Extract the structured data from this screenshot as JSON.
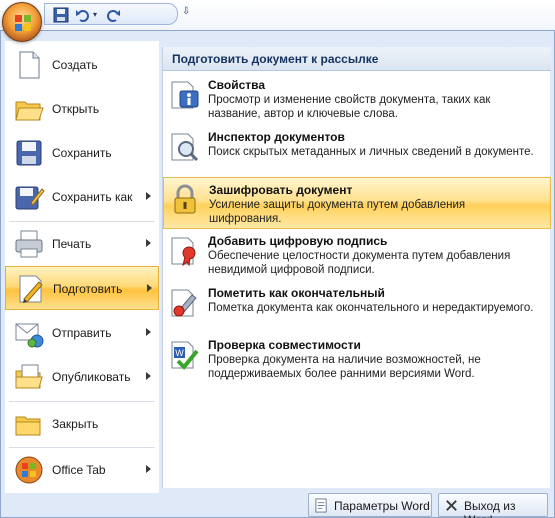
{
  "quick_access": {
    "icons": [
      "save-icon",
      "undo-icon",
      "redo-icon",
      "customize-icon"
    ]
  },
  "left_menu": {
    "items": [
      {
        "label": "Создать",
        "icon": "new-document-icon"
      },
      {
        "label": "Открыть",
        "icon": "open-folder-icon"
      },
      {
        "label": "Сохранить",
        "icon": "save-icon"
      },
      {
        "label": "Сохранить как",
        "icon": "save-as-icon"
      },
      {
        "label": "Печать",
        "icon": "printer-icon"
      },
      {
        "label": "Подготовить",
        "icon": "prepare-icon"
      },
      {
        "label": "Отправить",
        "icon": "send-icon"
      },
      {
        "label": "Опубликовать",
        "icon": "publish-icon"
      },
      {
        "label": "Закрыть",
        "icon": "close-folder-icon"
      },
      {
        "label": "Office Tab",
        "icon": "office-tab-icon"
      }
    ]
  },
  "submenu": {
    "title": "Подготовить документ к рассылке",
    "items": [
      {
        "title": "Свойства",
        "desc": "Просмотр и изменение свойств документа, таких как название, автор и ключевые слова.",
        "icon": "properties-icon"
      },
      {
        "title": "Инспектор документов",
        "desc": "Поиск скрытых метаданных и личных сведений в документе.",
        "icon": "inspector-icon"
      },
      {
        "title": "Зашифровать документ",
        "desc": "Усиление защиты документа путем добавления шифрования.",
        "icon": "lock-icon"
      },
      {
        "title": "Добавить цифровую подпись",
        "desc": "Обеспечение целостности документа путем добавления невидимой цифровой подписи.",
        "icon": "signature-icon"
      },
      {
        "title": "Пометить как окончательный",
        "desc": "Пометка документа как окончательного и нередактируемого.",
        "icon": "final-stamp-icon"
      },
      {
        "title": "Проверка совместимости",
        "desc": "Проверка документа на наличие возможностей, не поддерживаемых более ранними версиями Word.",
        "icon": "compatibility-icon"
      }
    ]
  },
  "footer": {
    "options_label": "Параметры Word",
    "exit_label": "Выход из Word"
  }
}
